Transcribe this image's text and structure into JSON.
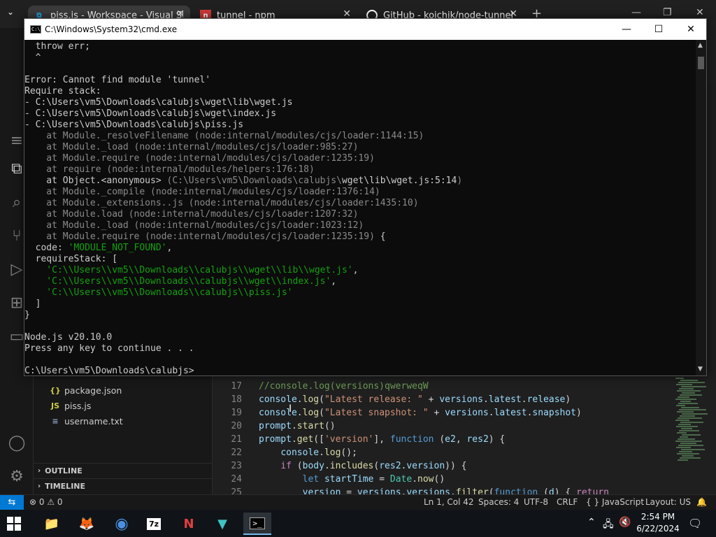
{
  "browser": {
    "tabs": [
      {
        "title": "piss.js - Workspace - Visual Stu",
        "icon": "vscode-icon",
        "color": "#23a9f2"
      },
      {
        "title": "tunnel - npm",
        "icon": "npm-icon",
        "color": "#cb3837"
      },
      {
        "title": "GitHub - koichik/node-tunnel",
        "icon": "github-icon",
        "color": "#ffffff"
      }
    ],
    "close_glyph": "✕",
    "new_tab_glyph": "+",
    "window_controls": {
      "minimize": "—",
      "restore": "❐",
      "close": "✕"
    }
  },
  "cmd": {
    "title": "C:\\Windows\\System32\\cmd.exe",
    "icon_text": "C:\\",
    "controls": {
      "minimize": "—",
      "maximize": "☐",
      "close": "✕"
    },
    "lines": [
      {
        "text": "  throw err;",
        "style": "normal"
      },
      {
        "text": "  ^",
        "style": "normal"
      },
      {
        "text": "",
        "style": "normal"
      },
      {
        "text": "Error: Cannot find module 'tunnel'",
        "style": "normal"
      },
      {
        "text": "Require stack:",
        "style": "normal"
      },
      {
        "text": "- C:\\Users\\vm5\\Downloads\\calubjs\\wget\\lib\\wget.js",
        "style": "normal"
      },
      {
        "text": "- C:\\Users\\vm5\\Downloads\\calubjs\\wget\\index.js",
        "style": "normal"
      },
      {
        "text": "- C:\\Users\\vm5\\Downloads\\calubjs\\piss.js",
        "style": "normal"
      },
      {
        "text": "    at Module._resolveFilename (node:internal/modules/cjs/loader:1144:15)",
        "style": "gray"
      },
      {
        "text": "    at Module._load (node:internal/modules/cjs/loader:985:27)",
        "style": "gray"
      },
      {
        "text": "    at Module.require (node:internal/modules/cjs/loader:1235:19)",
        "style": "gray"
      },
      {
        "text": "    at require (node:internal/modules/helpers:176:18)",
        "style": "gray"
      },
      {
        "text": "    at Object.<anonymous> (C:\\Users\\vm5\\Downloads\\calubjs\\wget\\lib\\wget.js:5:14)",
        "style": "mixed",
        "head": "    at Object.<anonymous> ",
        "mid": "(C:\\Users\\vm5\\Downloads\\calubjs\\",
        "tail": "wget\\lib\\wget.js:5:14",
        "end": ")"
      },
      {
        "text": "    at Module._compile (node:internal/modules/cjs/loader:1376:14)",
        "style": "gray"
      },
      {
        "text": "    at Module._extensions..js (node:internal/modules/cjs/loader:1435:10)",
        "style": "gray"
      },
      {
        "text": "    at Module.load (node:internal/modules/cjs/loader:1207:32)",
        "style": "gray"
      },
      {
        "text": "    at Module._load (node:internal/modules/cjs/loader:1023:12)",
        "style": "gray"
      },
      {
        "text": "    at Module.require (node:internal/modules/cjs/loader:1235:19) {",
        "style": "gray-brace"
      },
      {
        "text": "  code: 'MODULE_NOT_FOUND',",
        "style": "kv",
        "key": "  code: ",
        "value": "'MODULE_NOT_FOUND'",
        "after": ","
      },
      {
        "text": "  requireStack: [",
        "style": "normal"
      },
      {
        "text": "    'C:\\\\Users\\\\vm5\\\\Downloads\\\\calubjs\\\\wget\\\\lib\\\\wget.js',",
        "style": "green",
        "value": "    'C:\\\\Users\\\\vm5\\\\Downloads\\\\calubjs\\\\wget\\\\lib\\\\wget.js'",
        "after": ","
      },
      {
        "text": "    'C:\\\\Users\\\\vm5\\\\Downloads\\\\calubjs\\\\wget\\\\index.js',",
        "style": "green",
        "value": "    'C:\\\\Users\\\\vm5\\\\Downloads\\\\calubjs\\\\wget\\\\index.js'",
        "after": ","
      },
      {
        "text": "    'C:\\\\Users\\\\vm5\\\\Downloads\\\\calubjs\\\\piss.js'",
        "style": "green",
        "value": "    'C:\\\\Users\\\\vm5\\\\Downloads\\\\calubjs\\\\piss.js'",
        "after": ""
      },
      {
        "text": "  ]",
        "style": "normal"
      },
      {
        "text": "}",
        "style": "normal"
      },
      {
        "text": "",
        "style": "normal"
      },
      {
        "text": "Node.js v20.10.0",
        "style": "normal"
      },
      {
        "text": "Press any key to continue . . .",
        "style": "normal"
      },
      {
        "text": "",
        "style": "normal"
      },
      {
        "text": "C:\\Users\\vm5\\Downloads\\calubjs>",
        "style": "normal"
      }
    ]
  },
  "explorer": {
    "files": [
      {
        "name": "package.json",
        "icon": "{}"
      },
      {
        "name": "piss.js",
        "icon": "JS"
      },
      {
        "name": "username.txt",
        "icon": "≡"
      }
    ],
    "panels": [
      "OUTLINE",
      "TIMELINE"
    ]
  },
  "editor": {
    "lines": [
      {
        "n": "17",
        "tokens": [
          [
            "c-comment",
            "//console.log(versions)qwerweqW"
          ]
        ]
      },
      {
        "n": "18",
        "tokens": [
          [
            "c-var",
            "console"
          ],
          [
            "",
            "."
          ],
          [
            "c-fn",
            "log"
          ],
          [
            "",
            "("
          ],
          [
            "c-str",
            "\"Latest release: \""
          ],
          [
            "",
            " + "
          ],
          [
            "c-var",
            "versions"
          ],
          [
            "",
            "."
          ],
          [
            "c-var",
            "latest"
          ],
          [
            "",
            "."
          ],
          [
            "c-var",
            "release"
          ],
          [
            "",
            ")"
          ]
        ]
      },
      {
        "n": "19",
        "tokens": [
          [
            "c-var",
            "console"
          ],
          [
            "",
            "."
          ],
          [
            "c-fn",
            "log"
          ],
          [
            "",
            "("
          ],
          [
            "c-str",
            "\"Latest snapshot: \""
          ],
          [
            "",
            " + "
          ],
          [
            "c-var",
            "versions"
          ],
          [
            "",
            "."
          ],
          [
            "c-var",
            "latest"
          ],
          [
            "",
            "."
          ],
          [
            "c-var",
            "snapshot"
          ],
          [
            "",
            ")"
          ]
        ]
      },
      {
        "n": "20",
        "tokens": [
          [
            "c-var",
            "prompt"
          ],
          [
            "",
            "."
          ],
          [
            "c-fn",
            "start"
          ],
          [
            "",
            "()"
          ]
        ]
      },
      {
        "n": "21",
        "tokens": [
          [
            "c-var",
            "prompt"
          ],
          [
            "",
            "."
          ],
          [
            "c-fn",
            "get"
          ],
          [
            "",
            "(["
          ],
          [
            "c-str",
            "'version'"
          ],
          [
            "",
            "], "
          ],
          [
            "c-kw",
            "function"
          ],
          [
            "",
            " ("
          ],
          [
            "c-var",
            "e2"
          ],
          [
            "",
            ", "
          ],
          [
            "c-var",
            "res2"
          ],
          [
            "",
            ") {"
          ]
        ]
      },
      {
        "n": "22",
        "tokens": [
          [
            "",
            "    "
          ],
          [
            "c-var",
            "console"
          ],
          [
            "",
            "."
          ],
          [
            "c-fn",
            "log"
          ],
          [
            "",
            "();"
          ]
        ]
      },
      {
        "n": "23",
        "tokens": [
          [
            "",
            "    "
          ],
          [
            "c-ctl",
            "if"
          ],
          [
            "",
            " ("
          ],
          [
            "c-var",
            "body"
          ],
          [
            "",
            "."
          ],
          [
            "c-fn",
            "includes"
          ],
          [
            "",
            "("
          ],
          [
            "c-var",
            "res2"
          ],
          [
            "",
            "."
          ],
          [
            "c-var",
            "version"
          ],
          [
            "",
            ")) {"
          ]
        ]
      },
      {
        "n": "24",
        "tokens": [
          [
            "",
            "        "
          ],
          [
            "c-kw",
            "let"
          ],
          [
            "",
            " "
          ],
          [
            "c-var",
            "startTime"
          ],
          [
            "",
            " = "
          ],
          [
            "c-cls",
            "Date"
          ],
          [
            "",
            "."
          ],
          [
            "c-fn",
            "now"
          ],
          [
            "",
            "()"
          ]
        ]
      },
      {
        "n": "25",
        "tokens": [
          [
            "",
            "        "
          ],
          [
            "c-var",
            "version"
          ],
          [
            "",
            " = "
          ],
          [
            "c-var",
            "versions"
          ],
          [
            "",
            "."
          ],
          [
            "c-var",
            "versions"
          ],
          [
            "",
            "."
          ],
          [
            "c-fn",
            "filter"
          ],
          [
            "",
            "("
          ],
          [
            "c-kw",
            "function"
          ],
          [
            "",
            " ("
          ],
          [
            "c-var",
            "d"
          ],
          [
            "",
            ") { "
          ],
          [
            "c-ctl",
            "return"
          ]
        ]
      }
    ]
  },
  "statusbar": {
    "remote_glyph": "⇆",
    "problems": "⊗ 0 ⚠ 0",
    "position": "Ln 1, Col 42",
    "spaces": "Spaces: 4",
    "encoding": "UTF-8",
    "eol": "CRLF",
    "language": "{ } JavaScript",
    "layout": "Layout: US",
    "bell": "🔔"
  },
  "taskbar": {
    "time": "2:54 PM",
    "date": "6/22/2024",
    "apps": [
      {
        "name": "file-explorer",
        "label": "📁"
      },
      {
        "name": "firefox",
        "label": "🦊"
      },
      {
        "name": "chrome",
        "label": "◉"
      },
      {
        "name": "7zip",
        "label": "7z"
      },
      {
        "name": "app-n",
        "label": "N"
      },
      {
        "name": "shield-app",
        "label": "▼"
      },
      {
        "name": "cmd",
        "label": ">_"
      }
    ],
    "tray": {
      "chevron": "⌃",
      "network": "🖧",
      "volume": "🔇",
      "notification": "🗨"
    }
  }
}
